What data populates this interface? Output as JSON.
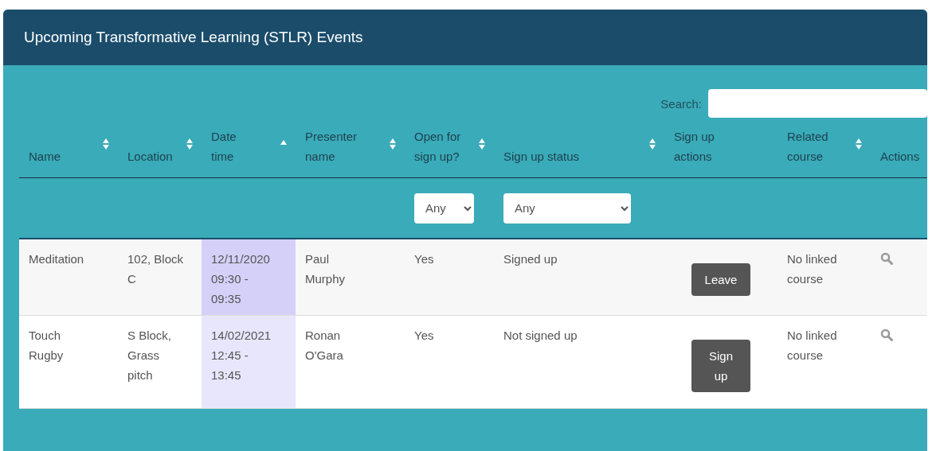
{
  "panel": {
    "title": "Upcoming Transformative Learning (STLR) Events"
  },
  "search": {
    "label": "Search:"
  },
  "columns": [
    {
      "label": "Name",
      "sortable": true,
      "sorted": false
    },
    {
      "label": "Location",
      "sortable": true,
      "sorted": false
    },
    {
      "label": "Date time",
      "sortable": true,
      "sorted": true
    },
    {
      "label": "Presenter name",
      "sortable": true,
      "sorted": false
    },
    {
      "label": "Open for sign up?",
      "sortable": true,
      "sorted": false,
      "filter": "Any"
    },
    {
      "label": "Sign up status",
      "sortable": true,
      "sorted": false,
      "filter": "Any"
    },
    {
      "label": "Sign up actions",
      "sortable": false
    },
    {
      "label": "Related course",
      "sortable": true,
      "sorted": false
    },
    {
      "label": "Actions",
      "sortable": false
    }
  ],
  "rows": [
    {
      "name": "Meditation",
      "location": "102, Block C",
      "datetime": "12/11/2020 09:30 - 09:35",
      "presenter": "Paul Murphy",
      "open": "Yes",
      "status": "Signed up",
      "action": "Leave",
      "course": "No linked course"
    },
    {
      "name": "Touch Rugby",
      "location": "S Block, Grass pitch",
      "datetime": "14/02/2021 12:45 - 13:45",
      "presenter": "Ronan O'Gara",
      "open": "Yes",
      "status": "Not signed up",
      "action": "Sign up",
      "course": "No linked course"
    }
  ]
}
